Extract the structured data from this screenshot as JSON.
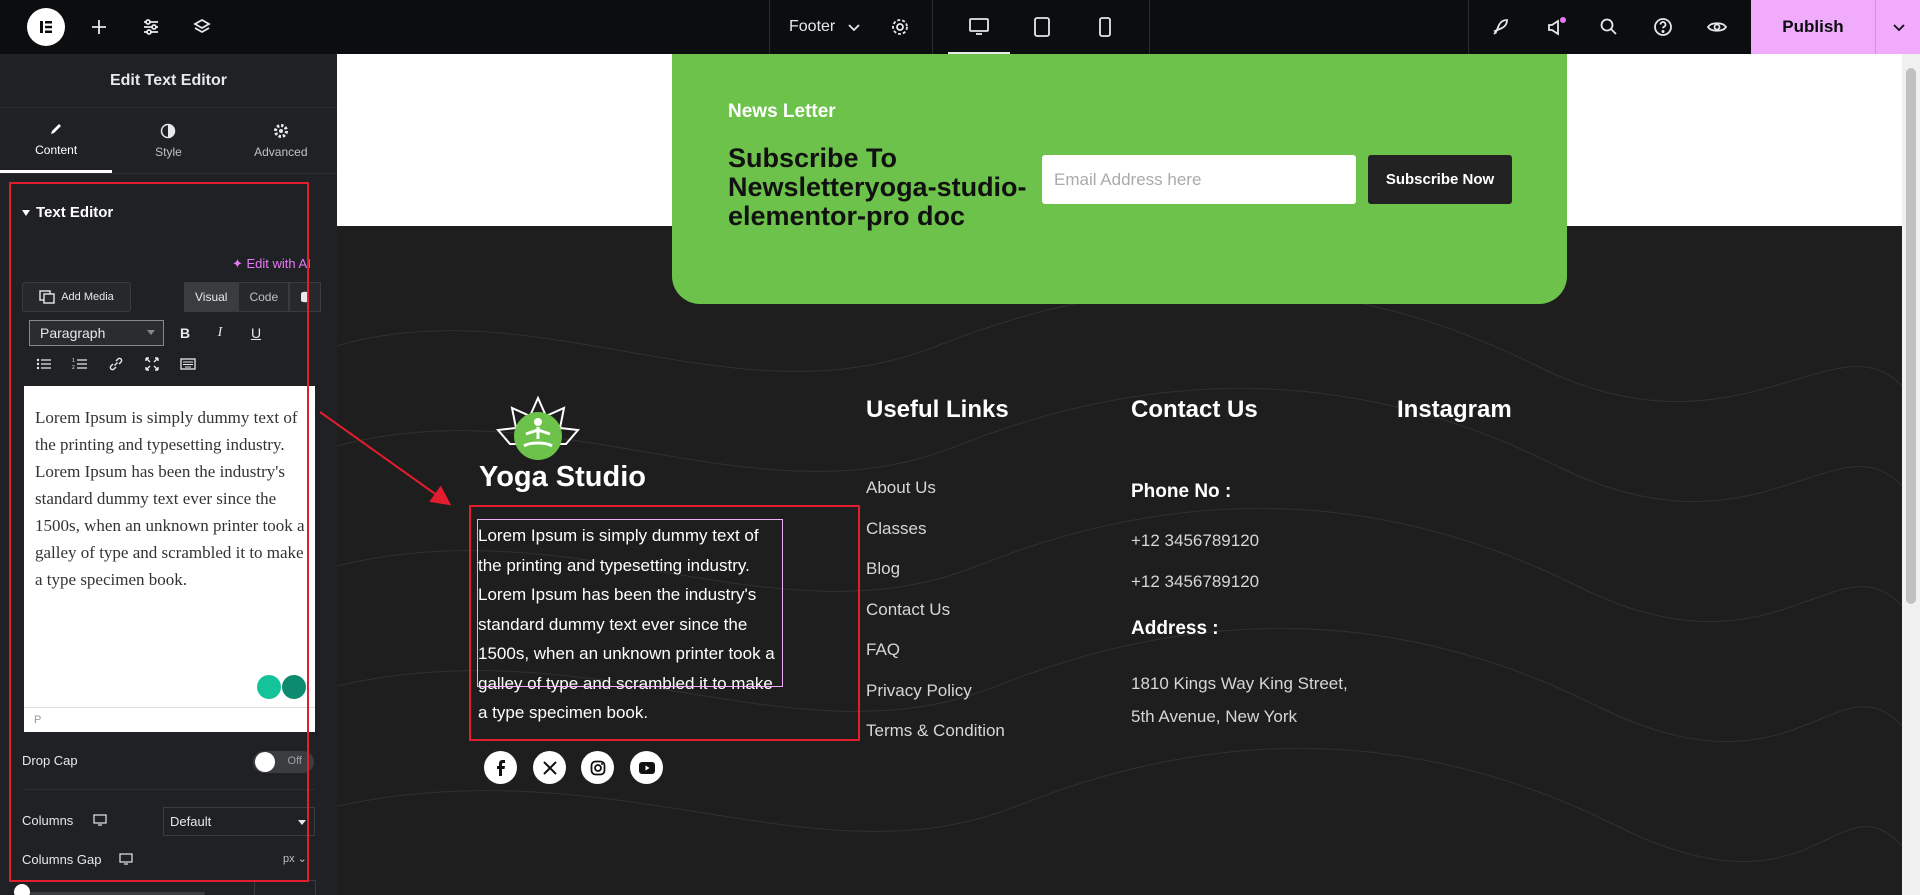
{
  "topbar": {
    "document_name": "Footer",
    "publish_label": "Publish",
    "icons": [
      "elementor-logo-icon",
      "add-icon",
      "settings-sliders-icon",
      "layers-icon",
      "chevron-down-icon",
      "gear-icon",
      "desktop-icon",
      "tablet-icon",
      "mobile-icon",
      "rocket-icon",
      "megaphone-icon",
      "search-icon",
      "help-icon",
      "eye-icon"
    ]
  },
  "panel": {
    "title": "Edit Text Editor",
    "tabs": [
      {
        "label": "Content",
        "active": true
      },
      {
        "label": "Style",
        "active": false
      },
      {
        "label": "Advanced",
        "active": false
      }
    ],
    "section_title": "Text Editor",
    "edit_with_ai": "Edit with AI",
    "add_media": "Add Media",
    "editor_tabs": [
      "Visual",
      "Code"
    ],
    "paragraph_select": "Paragraph",
    "toolbar_bold": "B",
    "toolbar_italic": "I",
    "toolbar_underline": "U",
    "editor_text": "Lorem Ipsum is simply dummy text of the printing and typesetting industry. Lorem Ipsum has been the industry's standard dummy text ever since the 1500s, when an unknown printer took a galley of type and scrambled it to make a type specimen book.",
    "editor_status": "P",
    "drop_cap_label": "Drop Cap",
    "drop_cap_value": "Off",
    "columns_label": "Columns",
    "columns_value": "Default",
    "columns_gap_label": "Columns Gap",
    "columns_gap_unit": "px"
  },
  "canvas": {
    "newsletter": {
      "small_title": "News Letter",
      "big_title": "Subscribe To Newsletteryoga-studio-elementor-pro doc",
      "email_placeholder": "Email Address here",
      "button": "Subscribe Now",
      "color": "#6cc24a"
    },
    "brand": "Yoga Studio",
    "about_text": "Lorem Ipsum is simply dummy text of the printing and typesetting industry. Lorem Ipsum has been the industry's standard dummy text ever since the 1500s, when an unknown printer took a galley of type and scrambled it to make a type specimen book.",
    "useful_links_title": "Useful Links",
    "useful_links": [
      "About Us",
      "Classes",
      "Blog",
      "Contact Us",
      "FAQ",
      "Privacy Policy",
      "Terms & Condition"
    ],
    "contact_title": "Contact Us",
    "phone_label": "Phone No :",
    "phones": [
      "+12 3456789120",
      "+12 3456789120"
    ],
    "address_label": "Address :",
    "address_lines": [
      "1810 Kings Way King Street,",
      "5th Avenue, New York"
    ],
    "instagram_title": "Instagram",
    "social_icons": [
      "facebook-icon",
      "x-icon",
      "instagram-icon",
      "youtube-icon"
    ]
  },
  "colors": {
    "accent": "#f0abfc",
    "panel_bg": "#1f2124",
    "footer_bg": "#1e1e1e",
    "annotation_red": "#e11d2e"
  }
}
